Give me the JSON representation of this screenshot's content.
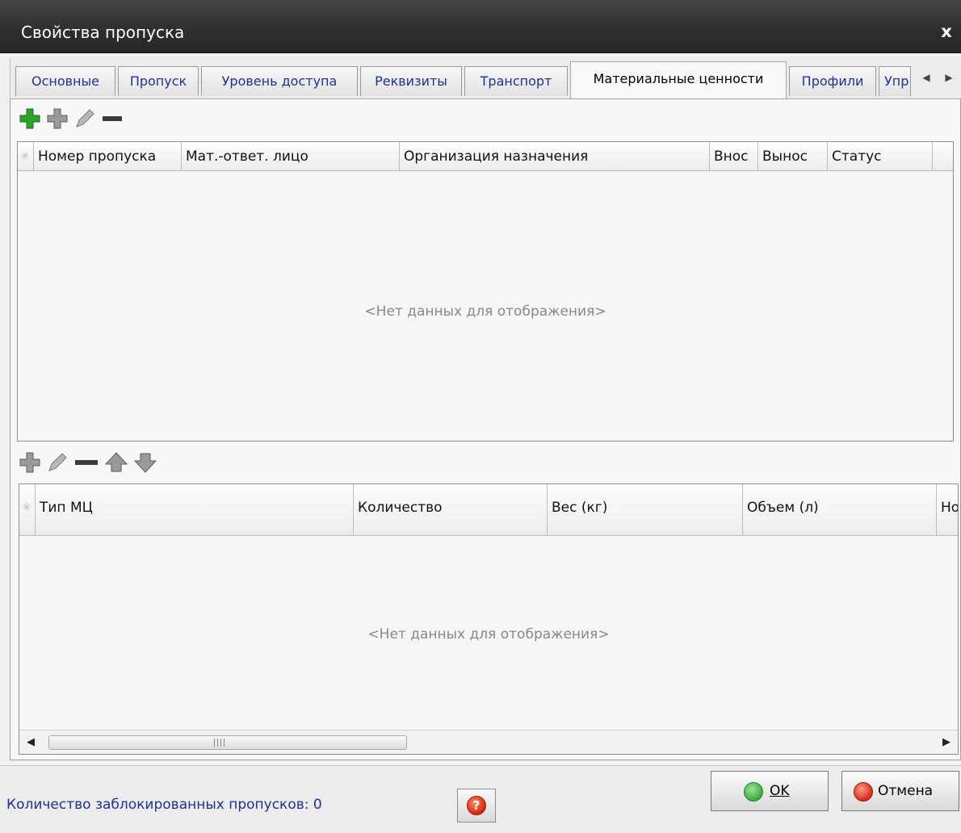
{
  "window": {
    "title": "Свойства пропуска",
    "close_label": "x"
  },
  "tabs": [
    {
      "label": "Основные",
      "active": false
    },
    {
      "label": "Пропуск",
      "active": false
    },
    {
      "label": "Уровень доступа",
      "active": false
    },
    {
      "label": "Реквизиты",
      "active": false
    },
    {
      "label": "Транспорт",
      "active": false
    },
    {
      "label": "Материальные ценности",
      "active": true
    },
    {
      "label": "Профили",
      "active": false
    },
    {
      "label": "Упр",
      "active": false
    }
  ],
  "top_toolbar": {
    "icons": [
      "add-green-icon",
      "add-gray-icon",
      "edit-pencil-icon",
      "remove-minus-icon"
    ]
  },
  "top_grid": {
    "star": "✳",
    "columns": [
      "Номер пропуска",
      "Мат.-ответ. лицо",
      "Организация назначения",
      "Внос",
      "Вынос",
      "Статус"
    ],
    "empty_text": "<Нет данных для отображения>"
  },
  "bottom_toolbar": {
    "icons": [
      "add-gray-icon",
      "edit-pencil-icon",
      "remove-minus-icon",
      "move-up-icon",
      "move-down-icon"
    ]
  },
  "bottom_grid": {
    "star": "✳",
    "columns": [
      "Тип МЦ",
      "Количество",
      "Вес (кг)",
      "Объем (л)",
      "Но"
    ],
    "empty_text": "<Нет данных для отображения>",
    "scroll_glyph": "III"
  },
  "footer": {
    "blocked_label": "Количество заблокированных пропусков: 0",
    "help_glyph": "?",
    "ok_label": "OK",
    "cancel_label": "Отмена"
  },
  "colors": {
    "link_text": "#22318f",
    "add_green": "#2aa52a",
    "ok_green": "#3cae3c",
    "cancel_red": "#d72a1a"
  }
}
